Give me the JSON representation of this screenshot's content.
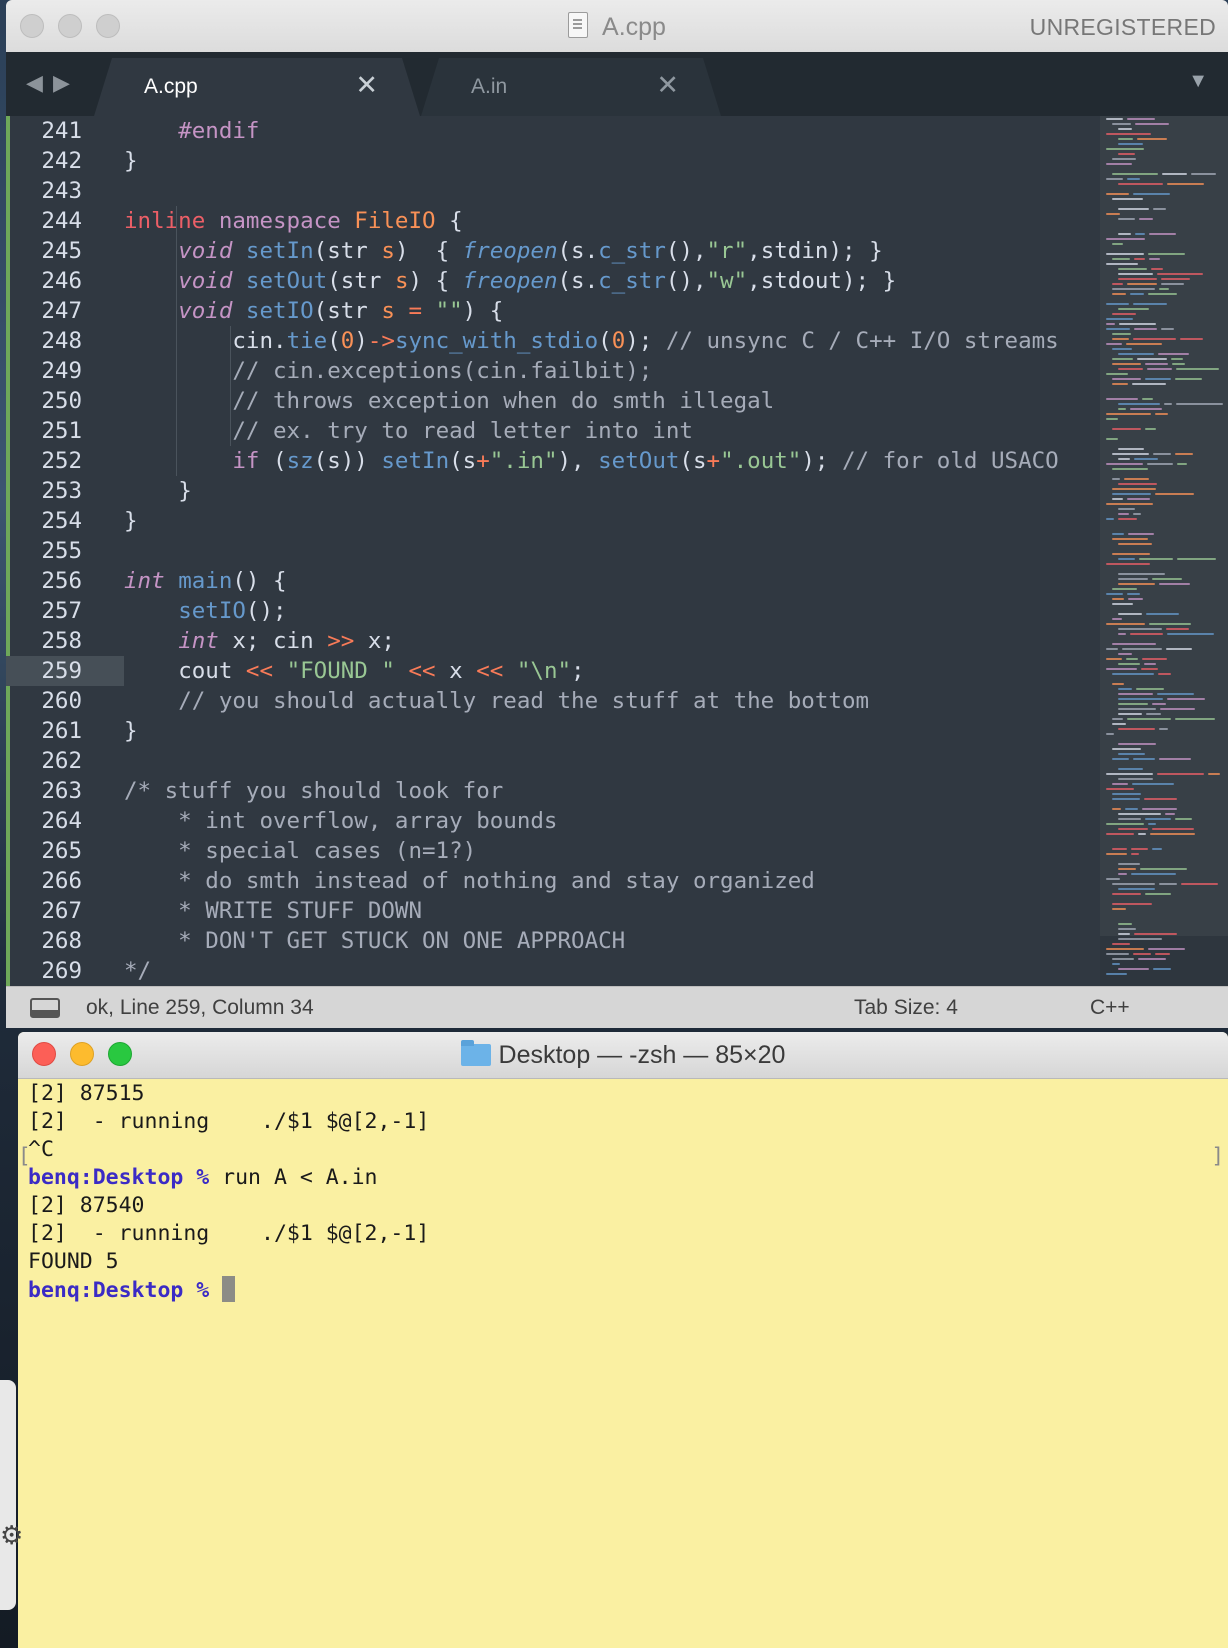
{
  "sublime": {
    "window_title": "A.cpp",
    "unregistered": "UNREGISTERED",
    "nav_arrows": "◀ ▶",
    "tabs": [
      {
        "label": "A.cpp",
        "close": "✕"
      },
      {
        "label": "A.in",
        "close": "✕"
      }
    ],
    "dropdown": "▼",
    "status": {
      "text": "ok, Line 259, Column 34",
      "tab_size": "Tab Size: 4",
      "syntax": "C++"
    },
    "highlighted_line": 259,
    "code_lines": [
      {
        "n": "241",
        "t": "    #endif"
      },
      {
        "n": "242",
        "t": "}"
      },
      {
        "n": "243",
        "t": ""
      },
      {
        "n": "244",
        "t": "inline namespace FileIO {"
      },
      {
        "n": "245",
        "t": "    void setIn(str s)  { freopen(s.c_str(),\"r\",stdin); }"
      },
      {
        "n": "246",
        "t": "    void setOut(str s) { freopen(s.c_str(),\"w\",stdout); }"
      },
      {
        "n": "247",
        "t": "    void setIO(str s = \"\") {"
      },
      {
        "n": "248",
        "t": "        cin.tie(0)->sync_with_stdio(0); // unsync C / C++ I/O streams"
      },
      {
        "n": "249",
        "t": "        // cin.exceptions(cin.failbit);"
      },
      {
        "n": "250",
        "t": "        // throws exception when do smth illegal"
      },
      {
        "n": "251",
        "t": "        // ex. try to read letter into int"
      },
      {
        "n": "252",
        "t": "        if (sz(s)) setIn(s+\".in\"), setOut(s+\".out\"); // for old USACO"
      },
      {
        "n": "253",
        "t": "    }"
      },
      {
        "n": "254",
        "t": "}"
      },
      {
        "n": "255",
        "t": ""
      },
      {
        "n": "256",
        "t": "int main() {"
      },
      {
        "n": "257",
        "t": "    setIO();"
      },
      {
        "n": "258",
        "t": "    int x; cin >> x;"
      },
      {
        "n": "259",
        "t": "    cout << \"FOUND \" << x << \"\\n\";"
      },
      {
        "n": "260",
        "t": "    // you should actually read the stuff at the bottom"
      },
      {
        "n": "261",
        "t": "}"
      },
      {
        "n": "262",
        "t": ""
      },
      {
        "n": "263",
        "t": "/* stuff you should look for"
      },
      {
        "n": "264",
        "t": "    * int overflow, array bounds"
      },
      {
        "n": "265",
        "t": "    * special cases (n=1?)"
      },
      {
        "n": "266",
        "t": "    * do smth instead of nothing and stay organized"
      },
      {
        "n": "267",
        "t": "    * WRITE STUFF DOWN"
      },
      {
        "n": "268",
        "t": "    * DON'T GET STUCK ON ONE APPROACH"
      },
      {
        "n": "269",
        "t": "*/"
      }
    ]
  },
  "terminal": {
    "window_title": "Desktop — -zsh — 85×20",
    "lines": [
      {
        "text": "[2] 87515"
      },
      {
        "text": "[2]  - running    ./$1 $@[2,-1]"
      },
      {
        "text": "^C"
      },
      {
        "prompt": "benq:Desktop %",
        "text": " run A < A.in"
      },
      {
        "text": "[2] 87540"
      },
      {
        "text": "[2]  - running    ./$1 $@[2,-1]"
      },
      {
        "text": "FOUND 5"
      },
      {
        "prompt": "benq:Desktop %",
        "text": " ",
        "cursor": true
      }
    ],
    "mark_left": "[",
    "mark_right": "]"
  },
  "colors": {
    "editor_bg": "#303841",
    "terminal_bg": "#faf0a2",
    "prompt": "#3b2bc5"
  }
}
